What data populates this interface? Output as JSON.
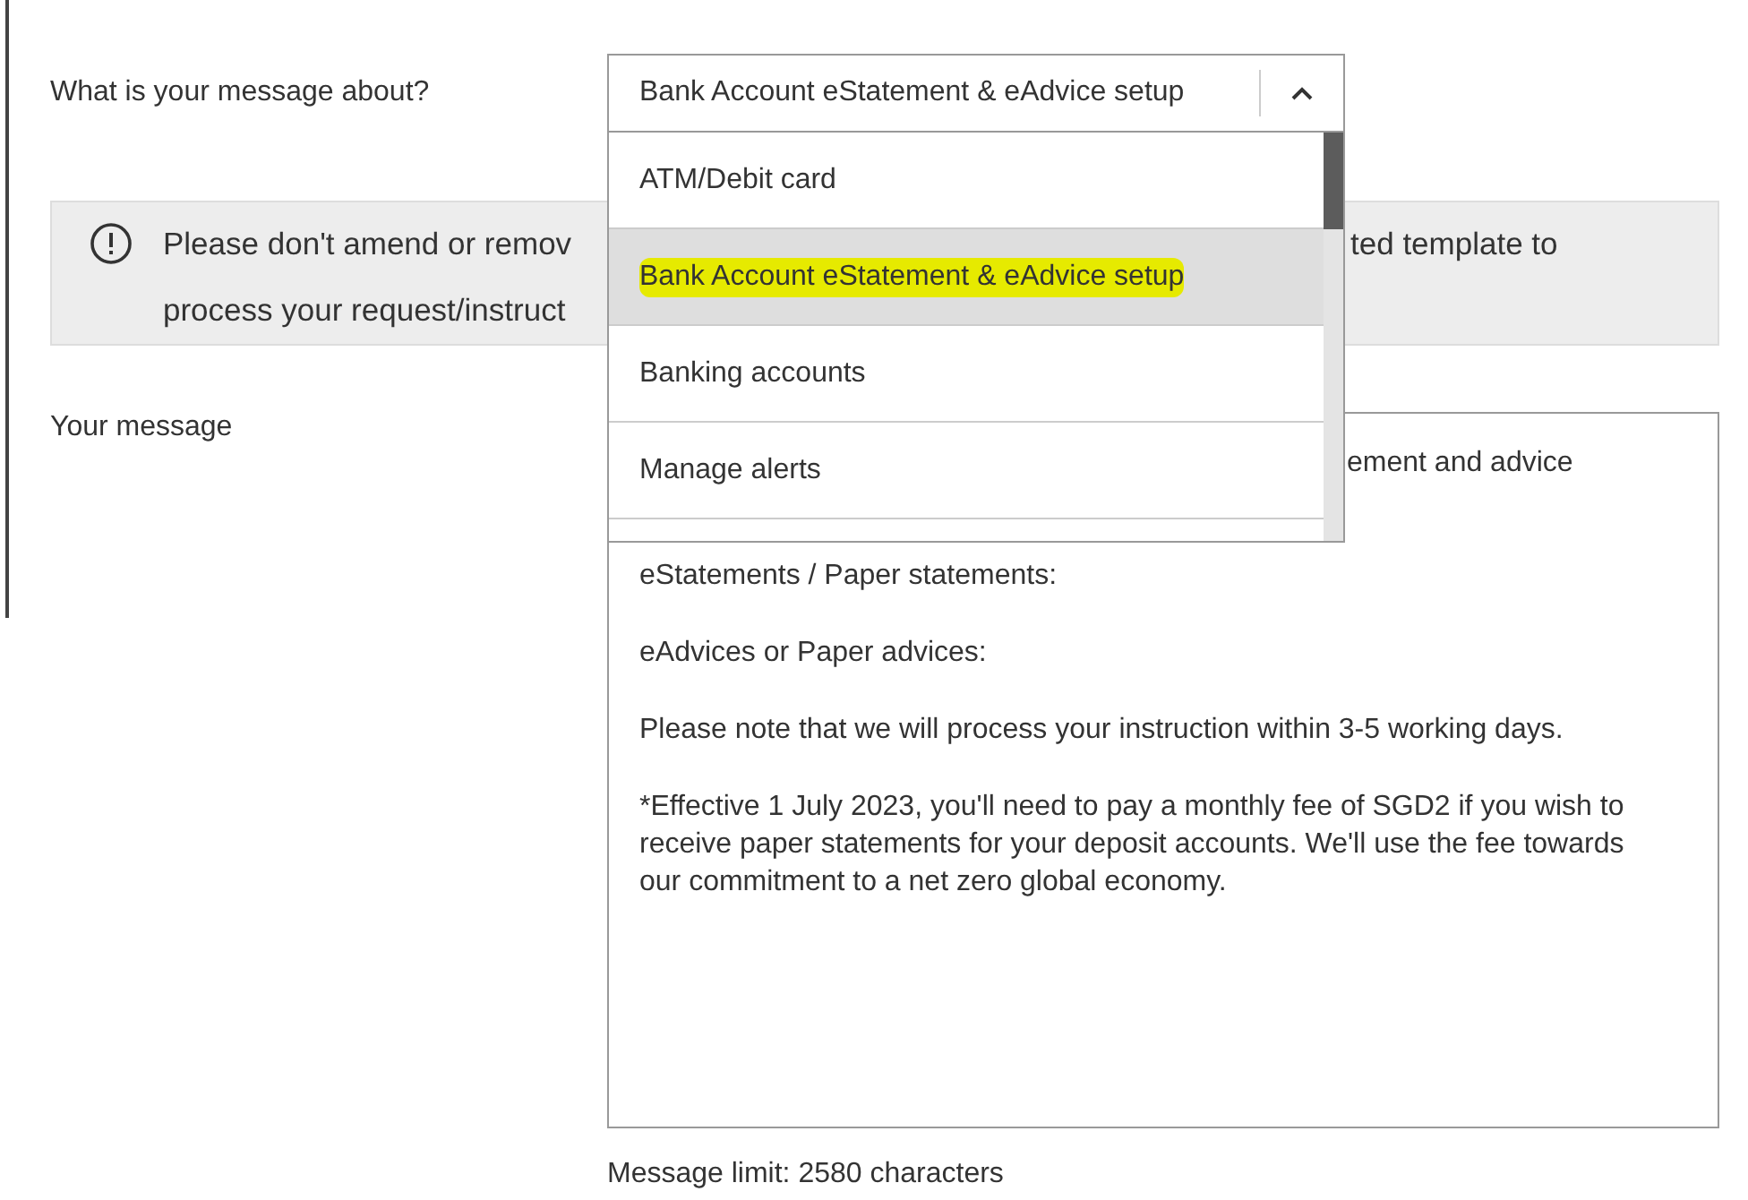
{
  "topic": {
    "label": "What is your message about?",
    "value": "Bank Account eStatement & eAdvice setup",
    "expanded": true,
    "options": [
      {
        "label": "ATM/Debit card",
        "selected": false,
        "highlighted": false
      },
      {
        "label": "Bank Account eStatement & eAdvice setup",
        "selected": true,
        "highlighted": true
      },
      {
        "label": "Banking accounts",
        "selected": false,
        "highlighted": false
      },
      {
        "label": "Manage alerts",
        "selected": false,
        "highlighted": false
      }
    ]
  },
  "notice": {
    "line_1_start": "Please don't amend or remov",
    "line_1_end": "ted template to",
    "line_2_start": "process your request/instruct"
  },
  "message": {
    "label": "Your message",
    "paragraphs": [
      "ement and advice",
      "eStatements / Paper statements:",
      "eAdvices or Paper advices:",
      "Please note that we will process your instruction within 3-5 working days.",
      "*Effective 1 July 2023, you'll need to pay a monthly fee of SGD2 if you wish to receive paper statements for your deposit accounts. We'll use the fee towards our commitment to a net zero global economy."
    ],
    "limit": "Message limit: 2580 characters"
  }
}
